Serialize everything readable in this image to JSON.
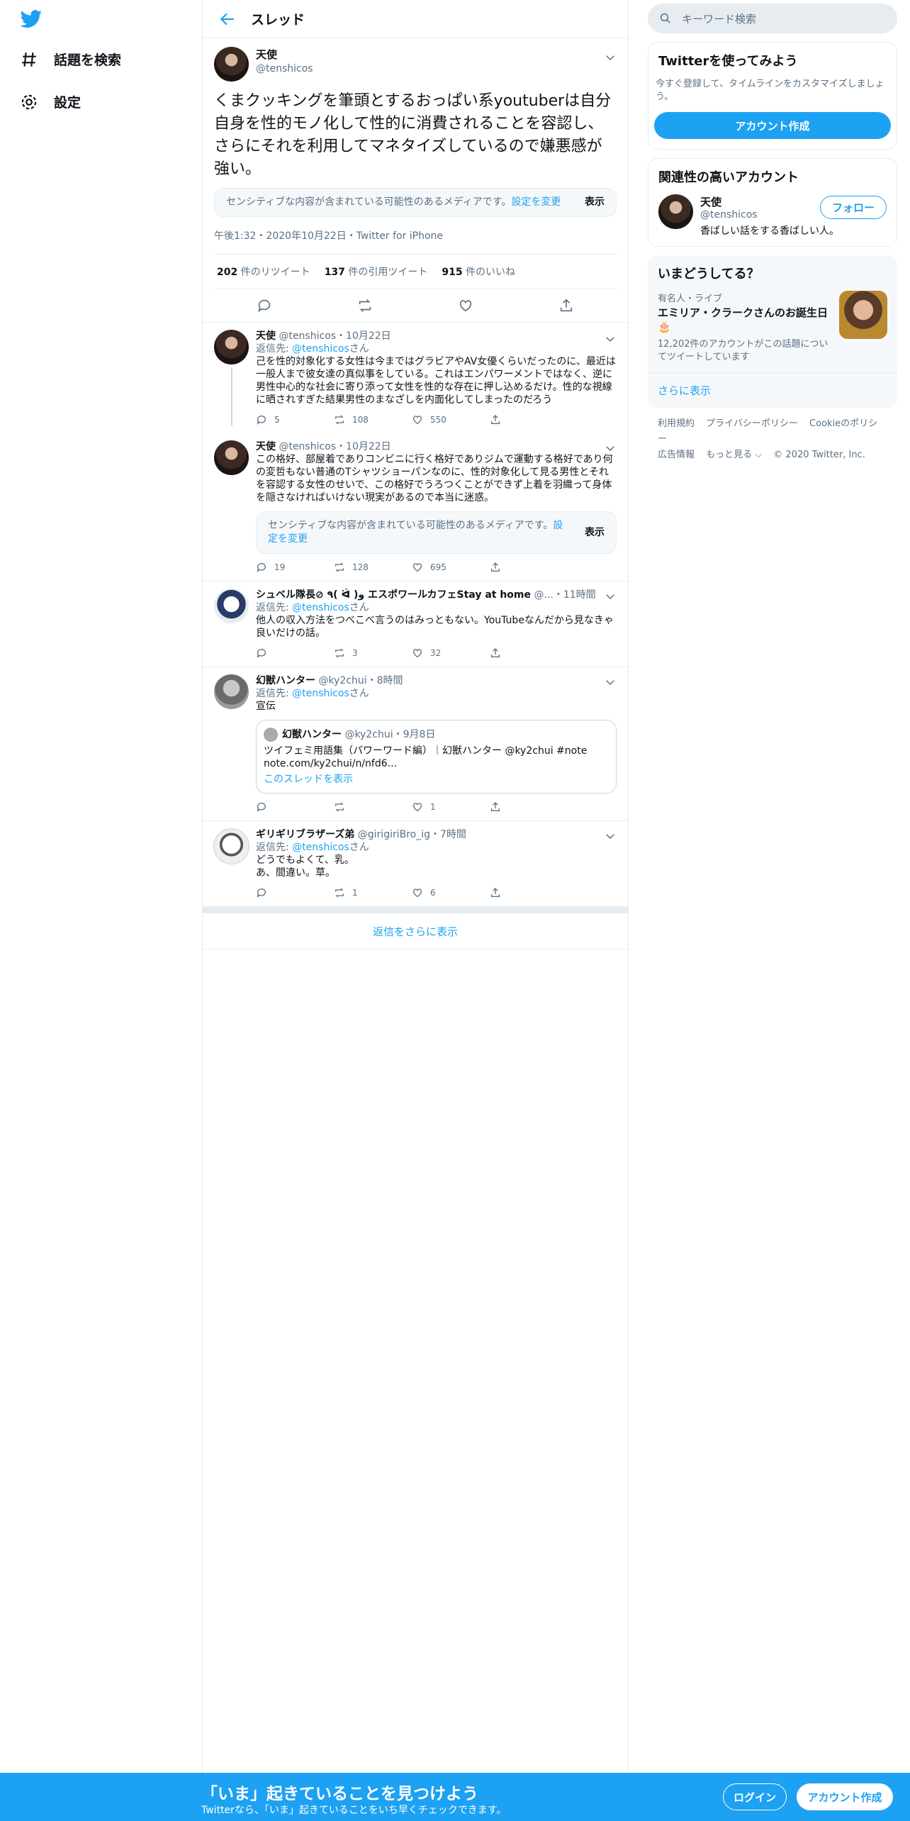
{
  "nav": {
    "explore_label": "話題を検索",
    "settings_label": "設定"
  },
  "header": {
    "title": "スレッド"
  },
  "main_tweet": {
    "name": "天使",
    "handle": "@tenshicos",
    "text": "くまクッキングを筆頭とするおっぱい系youtuberは自分自身を性的モノ化して性的に消費されることを容認し、さらにそれを利用してマネタイズしているので嫌悪感が強い。",
    "sensitive_text": "センシティブな内容が含まれている可能性のあるメディアです。",
    "sensitive_link": "設定を変更",
    "sensitive_show": "表示",
    "meta": "午後1:32・2020年10月22日・Twitter for iPhone",
    "retweets_count": "202",
    "retweets_label": " 件のリツイート",
    "quotes_count": "137",
    "quotes_label": " 件の引用ツイート",
    "likes_count": "915",
    "likes_label": " 件のいいね"
  },
  "replies": [
    {
      "name": "天使",
      "handle": "@tenshicos",
      "time": "・10月22日",
      "reply_prefix": "返信先: ",
      "reply_to": "@tenshicos",
      "reply_suffix": "さん",
      "text": "己を性的対象化する女性は今まではグラビアやAV女優くらいだったのに、最近は一般人まで彼女達の真似事をしている。これはエンパワーメントではなく、逆に男性中心的な社会に寄り添って女性を性的な存在に押し込めるだけ。性的な視線に晒されすぎた結果男性のまなざしを内面化してしまったのだろう",
      "replies": "5",
      "retweets": "108",
      "likes": "550"
    },
    {
      "name": "天使",
      "handle": "@tenshicos",
      "time": "・10月22日",
      "text": "この格好、部屋着でありコンビニに行く格好でありジムで運動する格好であり何の変哲もない普通のTシャツショーパンなのに、性的対象化して見る男性とそれを容認する女性のせいで、この格好でうろつくことができず上着を羽織って身体を隠さなければいけない現実があるので本当に迷惑。",
      "sensitive_text": "センシティブな内容が含まれている可能性のあるメディアです。",
      "sensitive_link": "設定を変更",
      "sensitive_show": "表示",
      "replies": "19",
      "retweets": "128",
      "likes": "695"
    },
    {
      "name": "シュベル隊長⊘ ٩( ᐛ )و エスポワールカフェStay at home",
      "handle": "@...",
      "time": "・11時間",
      "reply_prefix": "返信先: ",
      "reply_to": "@tenshicos",
      "reply_suffix": "さん",
      "text": "他人の収入方法をつべこべ言うのはみっともない。YouTubeなんだから見なきゃ良いだけの話。",
      "replies": "",
      "retweets": "3",
      "likes": "32"
    },
    {
      "name": "幻獣ハンター",
      "handle": "@ky2chui",
      "time": "・8時間",
      "reply_prefix": "返信先: ",
      "reply_to": "@tenshicos",
      "reply_suffix": "さん",
      "text": "宣伝",
      "quote": {
        "name": "幻獣ハンター",
        "handle": "@ky2chui",
        "time": "・9月8日",
        "line1": "ツイフェミ用語集（パワーワード編）｜幻獣ハンター @ky2chui #note",
        "line2": "note.com/ky2chui/n/nfd6...",
        "thread_link": "このスレッドを表示"
      },
      "replies": "",
      "retweets": "",
      "likes": "1"
    },
    {
      "name": "ギリギリブラザーズ弟",
      "handle": "@girigiriBro_ig",
      "time": "・7時間",
      "reply_prefix": "返信先: ",
      "reply_to": "@tenshicos",
      "reply_suffix": "さん",
      "text1": "どうでもよくて、乳。",
      "text2": "あ、間違い。草。",
      "replies": "",
      "retweets": "1",
      "likes": "6"
    }
  ],
  "more_replies": "返信をさらに表示",
  "search": {
    "placeholder": "キーワード検索"
  },
  "signup_card": {
    "title": "Twitterを使ってみよう",
    "subtitle": "今すぐ登録して、タイムラインをカスタマイズしましょう。",
    "button": "アカウント作成"
  },
  "related_card": {
    "title": "関連性の高いアカウント",
    "name": "天使",
    "handle": "@tenshicos",
    "bio": "香ばしい話をする香ばしい人。",
    "follow": "フォロー"
  },
  "trends_card": {
    "title": "いまどうしてる？",
    "category": "有名人・ライブ",
    "trend_title": "エミリア・クラークさんのお誕生日🎂",
    "count": "12,202件のアカウントがこの話題についてツイートしています",
    "show_more": "さらに表示"
  },
  "footer": {
    "terms": "利用規約",
    "privacy": "プライバシーポリシー",
    "cookie": "Cookieのポリシー",
    "ads": "広告情報",
    "more": "もっと見る ⌵",
    "copyright": "© 2020 Twitter, Inc."
  },
  "bottom_bar": {
    "title": "「いま」起きていることを見つけよう",
    "subtitle": "Twitterなら、「いま」起きていることをいち早くチェックできます。",
    "login": "ログイン",
    "signup": "アカウント作成"
  }
}
